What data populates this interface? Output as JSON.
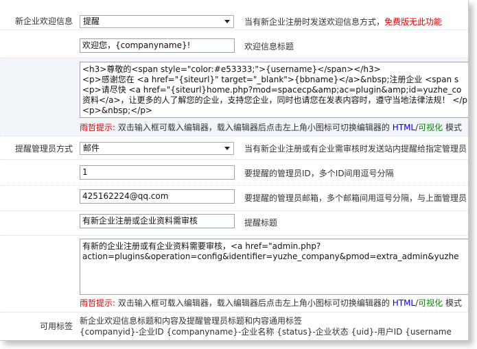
{
  "welcome_method": {
    "label": "新企业欢迎信息",
    "value": "提醒",
    "tip_prefix": "当有新企业注册时发送欢迎信息方式，",
    "tip_warning": "免费版无此功能"
  },
  "welcome_title": {
    "value": "欢迎您，{companyname}!",
    "tip": "欢迎信息标题"
  },
  "welcome_content": {
    "lines": [
      "<h3>尊敬的<span style=\"color:#e53333;\">{username}</span></h3>",
      "<p>感谢您在  <a href=\"{siteurl}\" target=\"_blank\">{bbname}</a>&nbsp;注册企业  <span s",
      "<p>请尽快  <a href=\"{siteurl}home.php?mod=spacecp&amp;ac=plugin&amp;id=yuzhe_co",
      "资料</a>，让更多的人了解您的企业，支持您企业，同时也请您在发表内容时，遵守当地法律法规！ </p>",
      "<p>&nbsp;</p>"
    ],
    "hint_prefix": "雨哲提示:",
    "hint_text": "双击输入框可载入编辑器，载入编辑器后点击左上角小图标可切换编辑器的",
    "hint_html": "HTML",
    "hint_slash": "/",
    "hint_visual": "可视化",
    "hint_suffix": "模式"
  },
  "admin_notify": {
    "label": "提醒管理员方式",
    "value": "邮件",
    "tip": "当有新企业注册或有企业需审核时发送站内提醒给指定管理员"
  },
  "admin_id": {
    "value": "1",
    "tip": "要提醒的管理员ID，多个ID间用逗号分隔"
  },
  "admin_email": {
    "value": "425162224@qq.com",
    "tip": "要提醒的管理员邮箱，多个邮箱间用逗号分隔，与上面管理员"
  },
  "notify_title": {
    "value": "有新企业注册或企业资料需审核",
    "tip": "提醒标题"
  },
  "notify_content": {
    "lines": [
      "有新的企业注册或有企业资料需要审核，<a href=\"admin.php?",
      "action=plugins&operation=config&identifier=yuzhe_company&pmod=extra_admin&yuzhe"
    ],
    "hint_prefix": "雨哲提示:",
    "hint_text": "双击输入框可载入编辑器，载入编辑器后点击左上角小图标可切换编辑器的",
    "hint_html": "HTML",
    "hint_slash": "/",
    "hint_visual": "可视化",
    "hint_suffix": "模式"
  },
  "tags": {
    "label": "可用标签",
    "line1": "新企业欢迎信息标题和内容及提醒管理员标题和内容通用标签",
    "line2": "{companyid}-企业ID {companyname}-企业名称 {status}-企业状态 {uid}-用户ID {username"
  }
}
